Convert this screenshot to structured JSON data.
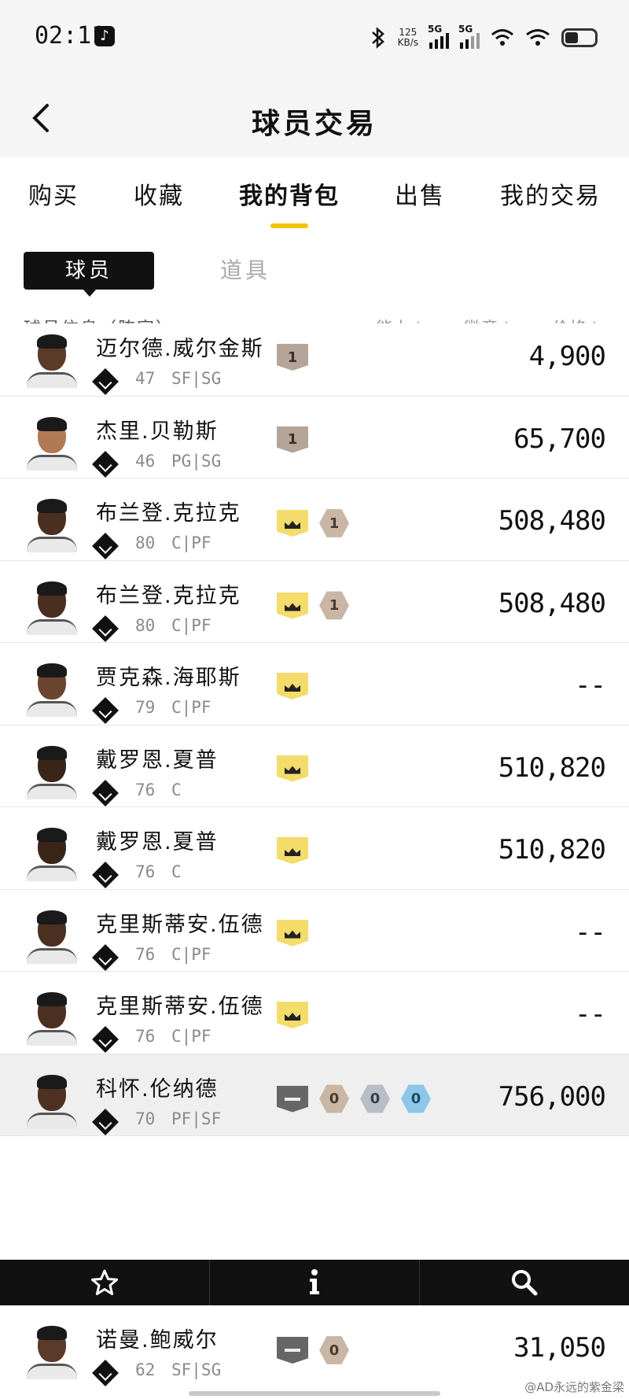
{
  "status_bar": {
    "time": "02:11",
    "net_speed_value": "125",
    "net_speed_unit": "KB/s",
    "signal_1_label": "5G",
    "signal_2_label": "5G"
  },
  "header": {
    "title": "球员交易"
  },
  "main_tabs": [
    {
      "label": "购买",
      "active": false
    },
    {
      "label": "收藏",
      "active": false
    },
    {
      "label": "我的背包",
      "active": true
    },
    {
      "label": "出售",
      "active": false
    },
    {
      "label": "我的交易",
      "active": false
    }
  ],
  "sub_tabs": {
    "players": "球员",
    "items": "道具"
  },
  "columns": {
    "info": "球员信息（阵容）",
    "ability": "能力",
    "badge": "徽章",
    "price": "价格"
  },
  "players": [
    {
      "name": "迈尔德.威尔金斯",
      "ovr": "47",
      "pos": "SF|SG",
      "badges": [
        {
          "type": "level",
          "text": "1"
        }
      ],
      "price": "4,900",
      "skin": "#5b3a28",
      "highlight": false
    },
    {
      "name": "杰里.贝勒斯",
      "ovr": "46",
      "pos": "PG|SG",
      "badges": [
        {
          "type": "level",
          "text": "1"
        }
      ],
      "price": "65,700",
      "skin": "#b07a55",
      "highlight": false
    },
    {
      "name": "布兰登.克拉克",
      "ovr": "80",
      "pos": "C|PF",
      "badges": [
        {
          "type": "crown",
          "text": ""
        },
        {
          "type": "bronze",
          "text": "1"
        }
      ],
      "price": "508,480",
      "skin": "#4a2e20",
      "highlight": false
    },
    {
      "name": "布兰登.克拉克",
      "ovr": "80",
      "pos": "C|PF",
      "badges": [
        {
          "type": "crown",
          "text": ""
        },
        {
          "type": "bronze",
          "text": "1"
        }
      ],
      "price": "508,480",
      "skin": "#4a2e20",
      "highlight": false
    },
    {
      "name": "贾克森.海耶斯",
      "ovr": "79",
      "pos": "C|PF",
      "badges": [
        {
          "type": "crown",
          "text": ""
        }
      ],
      "price": "--",
      "skin": "#6b4530",
      "highlight": false
    },
    {
      "name": "戴罗恩.夏普",
      "ovr": "76",
      "pos": "C",
      "badges": [
        {
          "type": "crown",
          "text": ""
        }
      ],
      "price": "510,820",
      "skin": "#3a2519",
      "highlight": false
    },
    {
      "name": "戴罗恩.夏普",
      "ovr": "76",
      "pos": "C",
      "badges": [
        {
          "type": "crown",
          "text": ""
        }
      ],
      "price": "510,820",
      "skin": "#3a2519",
      "highlight": false
    },
    {
      "name": "克里斯蒂安.伍德",
      "ovr": "76",
      "pos": "C|PF",
      "badges": [
        {
          "type": "crown",
          "text": ""
        }
      ],
      "price": "--",
      "skin": "#4b3022",
      "highlight": false
    },
    {
      "name": "克里斯蒂安.伍德",
      "ovr": "76",
      "pos": "C|PF",
      "badges": [
        {
          "type": "crown",
          "text": ""
        }
      ],
      "price": "--",
      "skin": "#4b3022",
      "highlight": false
    },
    {
      "name": "科怀.伦纳德",
      "ovr": "70",
      "pos": "PF|SF",
      "badges": [
        {
          "type": "gray",
          "text": ""
        },
        {
          "type": "bronze",
          "text": "0"
        },
        {
          "type": "silver",
          "text": "0"
        },
        {
          "type": "blue",
          "text": "0"
        }
      ],
      "price": "756,000",
      "skin": "#4e3122",
      "highlight": true
    }
  ],
  "bottom_player": {
    "name": "诺曼.鲍威尔",
    "ovr": "62",
    "pos": "SF|SG",
    "badges": [
      {
        "type": "gray",
        "text": ""
      },
      {
        "type": "bronze",
        "text": "0"
      }
    ],
    "price": "31,050",
    "skin": "#5a3a28"
  },
  "action_bar": {
    "favorite_icon": "star-icon",
    "info_icon": "info-icon",
    "search_icon": "search-icon"
  },
  "watermark": "@AD永远的紫金梁",
  "colors": {
    "accent": "#f2c400",
    "action_bar_bg": "#111111"
  }
}
